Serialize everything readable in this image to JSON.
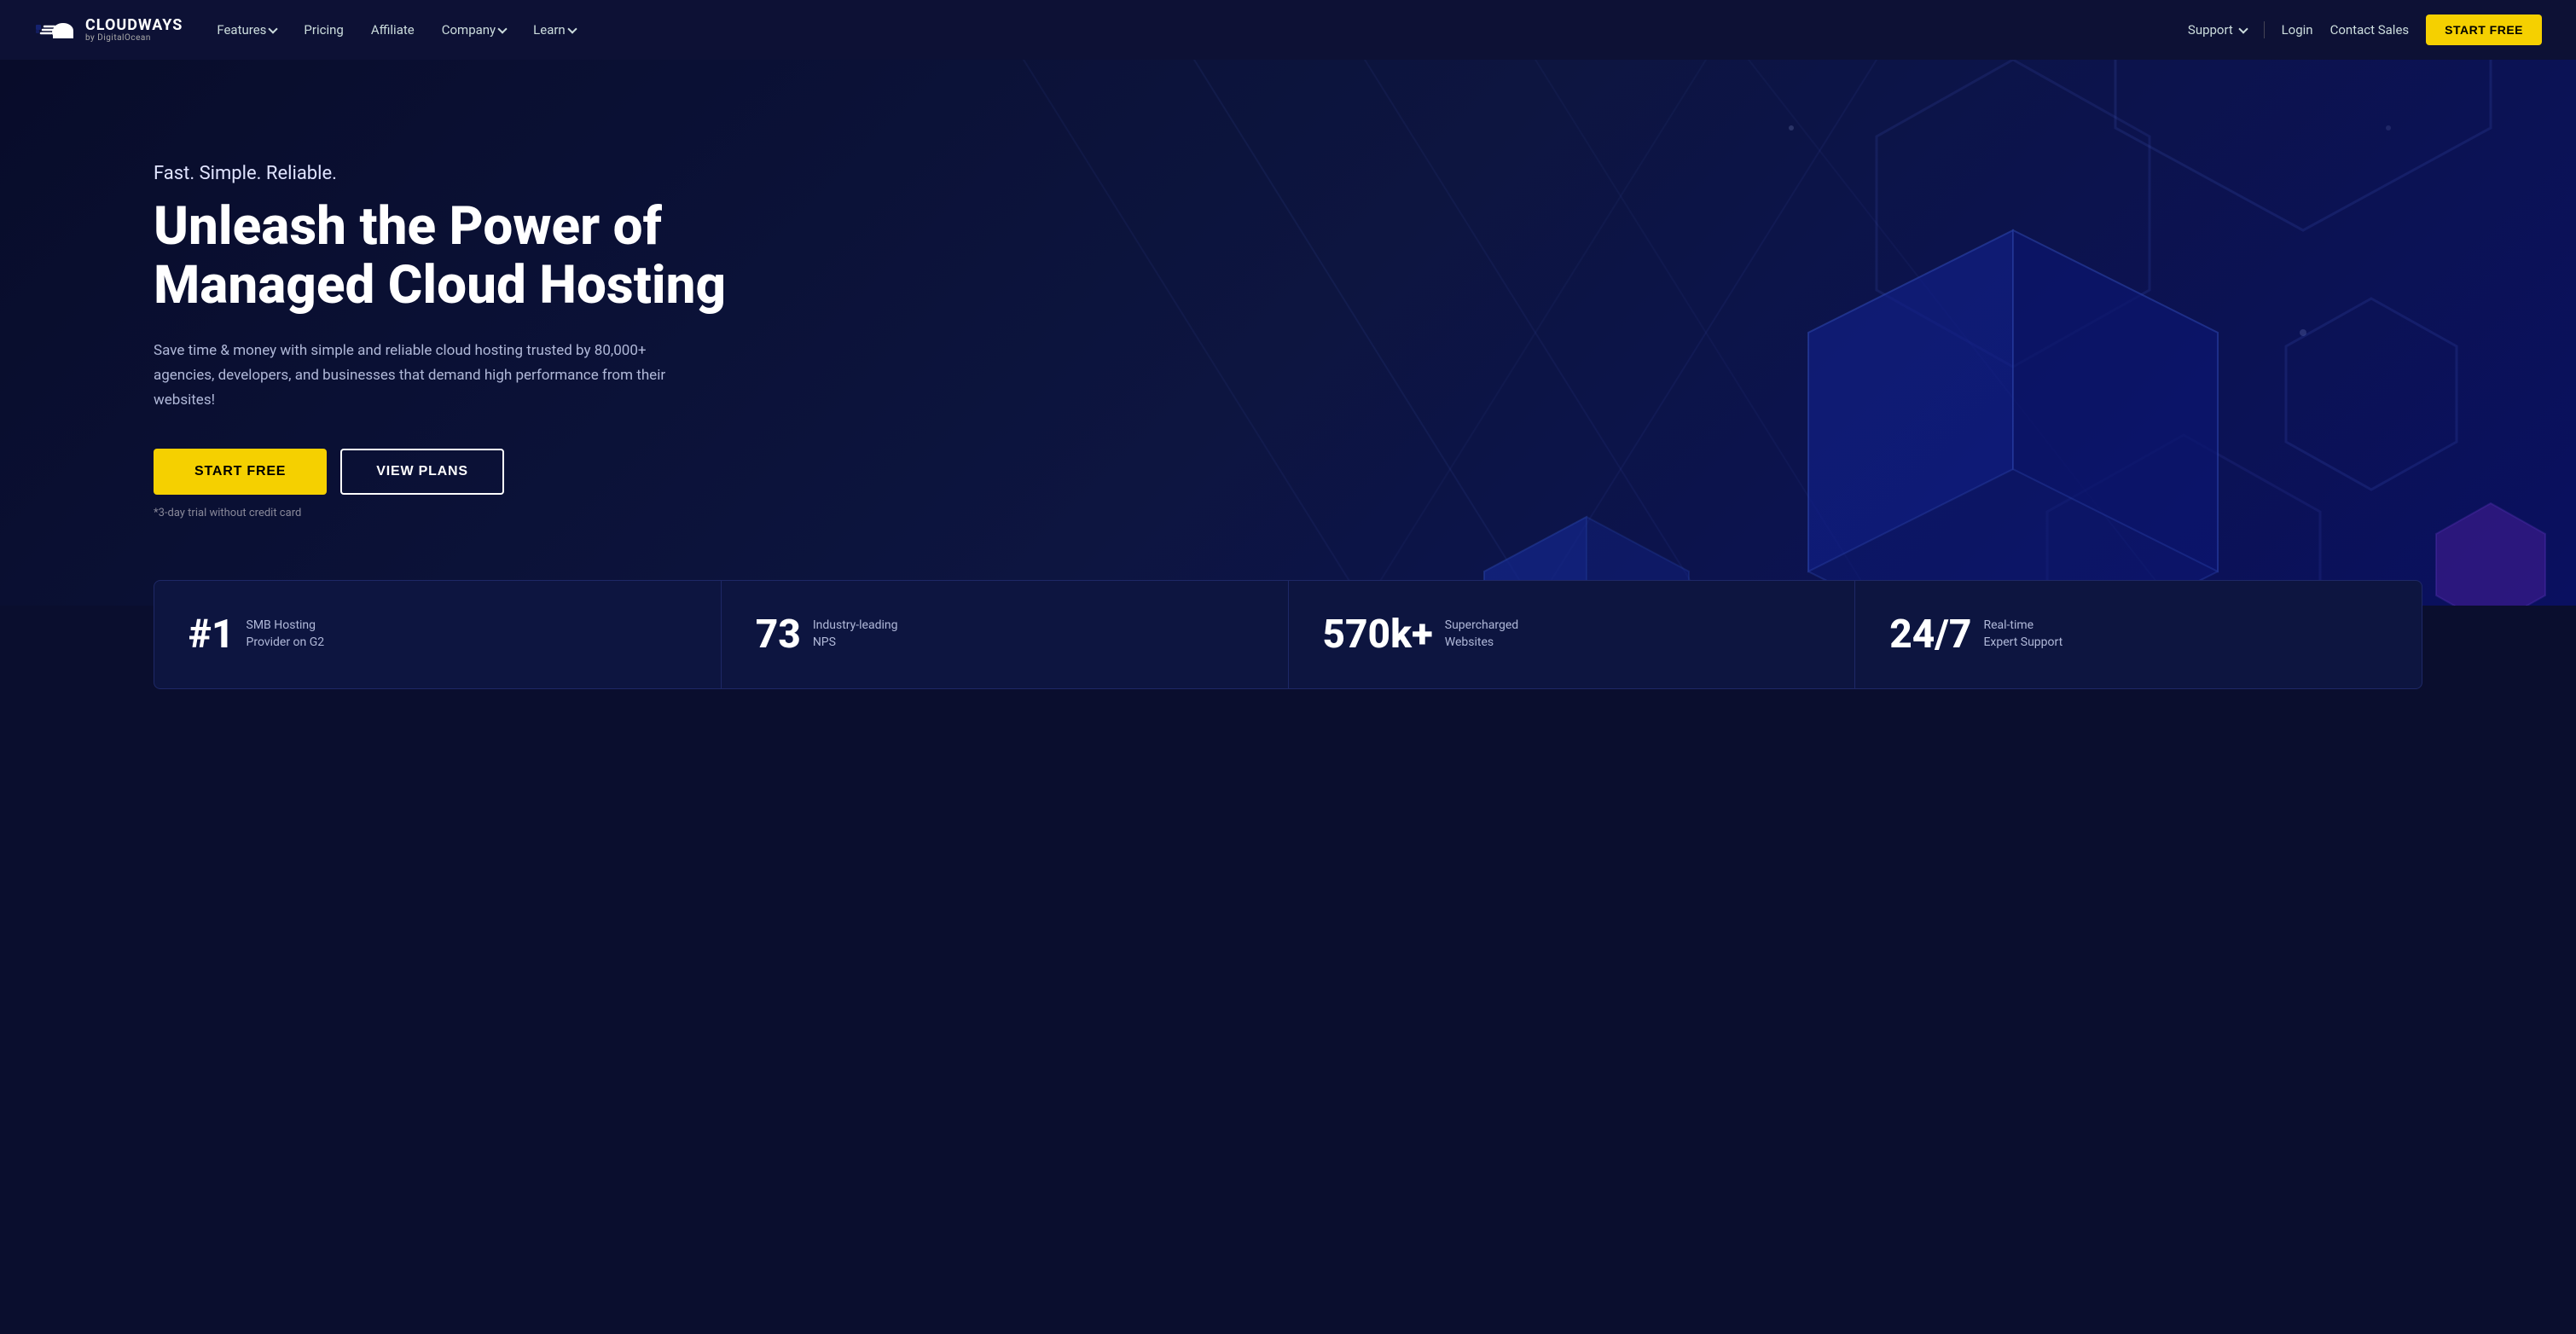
{
  "brand": {
    "name": "CLOUDWAYS",
    "sub": "by DigitalOcean"
  },
  "nav": {
    "links": [
      {
        "label": "Features",
        "has_dropdown": true
      },
      {
        "label": "Pricing",
        "has_dropdown": false
      },
      {
        "label": "Affiliate",
        "has_dropdown": false
      },
      {
        "label": "Company",
        "has_dropdown": true
      },
      {
        "label": "Learn",
        "has_dropdown": true
      }
    ],
    "right_links": [
      {
        "label": "Support",
        "has_dropdown": true
      },
      {
        "label": "Login"
      },
      {
        "label": "Contact Sales"
      }
    ],
    "cta_label": "START FREE"
  },
  "hero": {
    "tagline": "Fast. Simple. Reliable.",
    "title": "Unleash the Power of\nManaged Cloud Hosting",
    "description": "Save time & money with simple and reliable cloud hosting trusted by 80,000+ agencies, developers, and businesses that demand high performance from their websites!",
    "cta_primary": "START FREE",
    "cta_secondary": "VIEW PLANS",
    "trial_note": "*3-day trial without credit card"
  },
  "stats": [
    {
      "number": "#1",
      "label": "SMB Hosting Provider on G2"
    },
    {
      "number": "73",
      "label": "Industry-leading NPS"
    },
    {
      "number": "570k+",
      "label": "Supercharged Websites"
    },
    {
      "number": "24/7",
      "label": "Real-time Expert Support"
    }
  ]
}
